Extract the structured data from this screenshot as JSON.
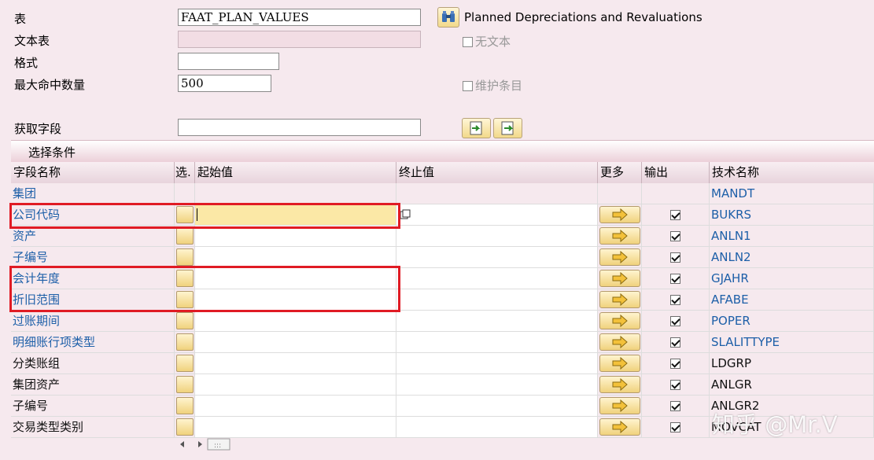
{
  "form": {
    "table_label": "表",
    "table_value": "FAAT_PLAN_VALUES",
    "table_desc": "Planned Depreciations and Revaluations",
    "text_table_label": "文本表",
    "no_text_label": "无文本",
    "format_label": "格式",
    "max_hits_label": "最大命中数量",
    "max_hits_value": "500",
    "maintain_entries_label": "维护条目",
    "fetch_field_label": "获取字段"
  },
  "section": {
    "title": "选择条件"
  },
  "columns": {
    "field_name": "字段名称",
    "sel": "选.",
    "from": "起始值",
    "to": "终止值",
    "more": "更多",
    "output": "输出",
    "tech_name": "技术名称"
  },
  "rows": [
    {
      "name": "集团",
      "tech": "MANDT"
    },
    {
      "name": "公司代码",
      "tech": "BUKRS"
    },
    {
      "name": "资产",
      "tech": "ANLN1"
    },
    {
      "name": "子编号",
      "tech": "ANLN2"
    },
    {
      "name": "会计年度",
      "tech": "GJAHR"
    },
    {
      "name": "折旧范围",
      "tech": "AFABE"
    },
    {
      "name": "过账期间",
      "tech": "POPER"
    },
    {
      "name": "明细账行项类型",
      "tech": "SLALITTYPE"
    },
    {
      "name": "分类账组",
      "tech": "LDGRP"
    },
    {
      "name": "集团资产",
      "tech": "ANLGR"
    },
    {
      "name": "子编号",
      "tech": "ANLGR2"
    },
    {
      "name": "交易类型类别",
      "tech": "MOVCAT"
    }
  ],
  "watermark": "知乎 @Mr.V",
  "colors": {
    "highlight_box": "#e01b24",
    "link_blue": "#1d5fa8",
    "background": "#f6e9ee"
  }
}
